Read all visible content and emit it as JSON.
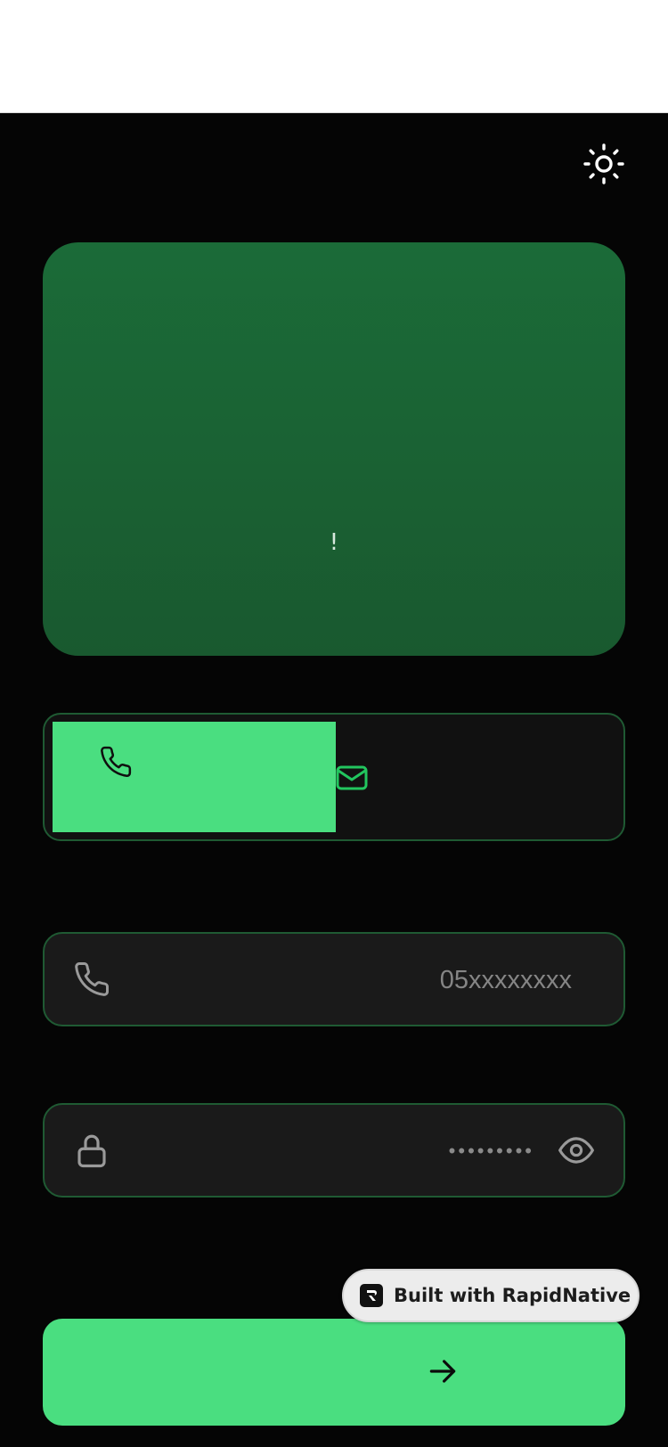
{
  "hero": {
    "text": "!"
  },
  "login_method": {
    "selected": "phone",
    "options": [
      "phone-icon",
      "mail-icon"
    ]
  },
  "phone_field": {
    "value": "",
    "placeholder": "05xxxxxxxx"
  },
  "password_field": {
    "value": "",
    "placeholder": "•••••••••"
  },
  "badge": {
    "label": "Built with RapidNative"
  },
  "colors": {
    "background": "#050505",
    "hero": "#1b6b38",
    "accent": "#4ade80",
    "field_background": "#1a1a1a",
    "field_border": "#1f5a33"
  }
}
